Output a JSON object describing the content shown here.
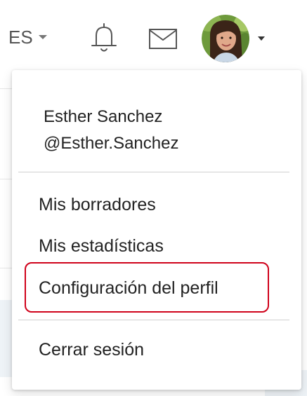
{
  "header": {
    "language": {
      "label": "ES",
      "icon": "chevron-down-icon"
    },
    "notifications_icon": "bell-icon",
    "messages_icon": "mail-icon",
    "avatar_icon": "user-avatar",
    "avatar_caret_icon": "caret-down-icon"
  },
  "user_menu": {
    "name": "Esther Sanchez",
    "handle": "@Esther.Sanchez",
    "items": [
      {
        "label": "Mis borradores"
      },
      {
        "label": "Mis estadísticas"
      },
      {
        "label": "Configuración del perfil",
        "highlighted": true
      },
      {
        "label": "Cerrar sesión"
      }
    ]
  },
  "colors": {
    "highlight_border": "#d0021b",
    "text": "#222222",
    "icon": "#555555"
  }
}
